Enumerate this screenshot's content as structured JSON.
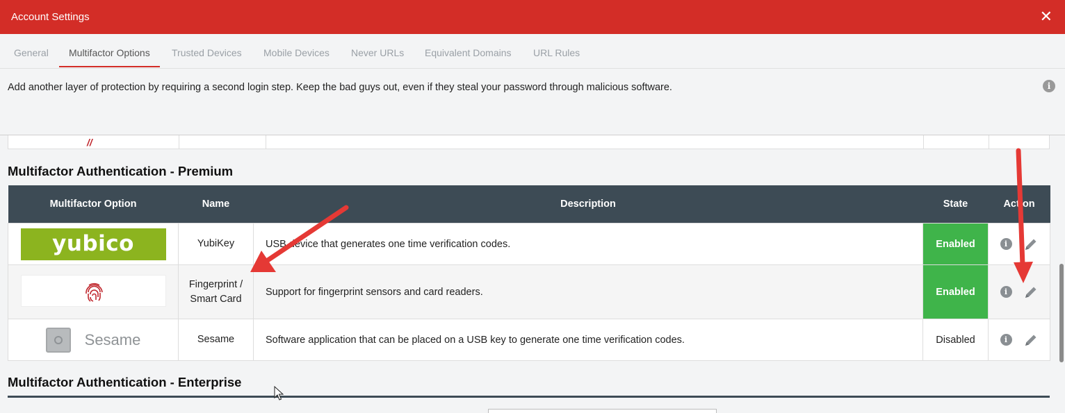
{
  "window": {
    "title": "Account Settings",
    "close_glyph": "✕"
  },
  "tabs": [
    {
      "label": "General",
      "active": false
    },
    {
      "label": "Multifactor Options",
      "active": true
    },
    {
      "label": "Trusted Devices",
      "active": false
    },
    {
      "label": "Mobile Devices",
      "active": false
    },
    {
      "label": "Never URLs",
      "active": false
    },
    {
      "label": "Equivalent Domains",
      "active": false
    },
    {
      "label": "URL Rules",
      "active": false
    }
  ],
  "intro": {
    "text": "Add another layer of protection by requiring a second login step. Keep the bad guys out, even if they steal your password through malicious software.",
    "info_glyph": "i"
  },
  "premium": {
    "title": "Multifactor Authentication - Premium",
    "columns": [
      "Multifactor Option",
      "Name",
      "Description",
      "State",
      "Action"
    ],
    "rows": [
      {
        "logo": "yubico",
        "name": "YubiKey",
        "description": "USB device that generates one time verification codes.",
        "state": "Enabled"
      },
      {
        "logo": "fingerprint-icon",
        "name": "Fingerprint / Smart Card",
        "description": "Support for fingerprint sensors and card readers.",
        "state": "Enabled"
      },
      {
        "logo": "Sesame",
        "name": "Sesame",
        "description": "Software application that can be placed on a USB key to generate one time verification codes.",
        "state": "Disabled"
      }
    ]
  },
  "enterprise": {
    "title": "Multifactor Authentication - Enterprise"
  },
  "icons": {
    "info": "info-icon",
    "edit": "pencil-icon",
    "close": "close-icon",
    "fingerprint": "fingerprint-icon",
    "safe": "safe-icon"
  },
  "colors": {
    "titlebar": "#d32d27",
    "active_tab_underline": "#d32d27",
    "table_header": "#3d4b55",
    "enabled": "#3fb44a",
    "yubico": "#8cb41f",
    "annotation_arrow": "#e53935"
  }
}
